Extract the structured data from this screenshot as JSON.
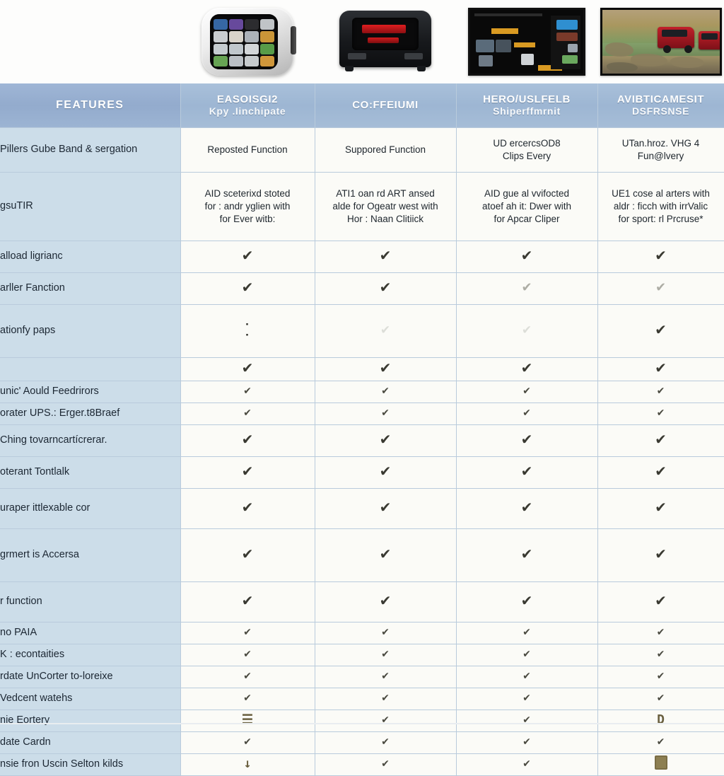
{
  "products": [
    {
      "name": "handheld-touchscreen-scanner",
      "type": "phone"
    },
    {
      "name": "rugged-diagnostic-tool",
      "type": "box"
    },
    {
      "name": "software-interface-screenshot",
      "type": "ui"
    },
    {
      "name": "offroad-vehicle-photo",
      "type": "photo"
    }
  ],
  "table": {
    "header": {
      "feature_label": "FEATURES",
      "columns": [
        {
          "title": "EASOISGI2",
          "subtitle": "Kpy .Iinchipate"
        },
        {
          "title": "CO:FFEIUMI",
          "subtitle": ""
        },
        {
          "title": "HERO/USLFELB",
          "subtitle": "Shiperffmrnit"
        },
        {
          "title": "AVIBTICAMESIT",
          "subtitle": "DSFRSNSE"
        }
      ]
    },
    "rows": [
      {
        "feature": "Pillers Gube Band & sergation",
        "size": "r-lead",
        "cells": [
          {
            "kind": "text",
            "lines": [
              "Reposted Function"
            ]
          },
          {
            "kind": "text",
            "lines": [
              "Suppored Function"
            ]
          },
          {
            "kind": "text",
            "lines": [
              "UD ercercsOD8",
              "Clips Every"
            ]
          },
          {
            "kind": "text",
            "lines": [
              "UTan.hroz. VHG 4",
              "Fun@lvery"
            ]
          }
        ]
      },
      {
        "feature": "gsuTIR",
        "size": "r-xtall",
        "cells": [
          {
            "kind": "text",
            "lines": [
              "AID sceterixd stoted",
              "for : andr yglien with",
              "for Ever witb:"
            ]
          },
          {
            "kind": "text",
            "lines": [
              "ATI1 oan rd ART ansed",
              "alde for Ogeatr west with",
              "Hor : Naan Clitiick"
            ]
          },
          {
            "kind": "text",
            "lines": [
              "AID gue al vvifocted",
              "atoef ah it: Dwer with",
              "for Apcar Cliper"
            ]
          },
          {
            "kind": "text",
            "lines": [
              "UE1 cose al arters with",
              "aldr : ficch with irrValic",
              "for sport: rl Prcruse*"
            ]
          }
        ]
      },
      {
        "feature": "alload ligrianc",
        "size": "r-reg",
        "cells": [
          {
            "kind": "check",
            "style": "big"
          },
          {
            "kind": "check",
            "style": "big"
          },
          {
            "kind": "check",
            "style": "big"
          },
          {
            "kind": "check",
            "style": "big"
          }
        ]
      },
      {
        "feature": "arller Fanction",
        "size": "r-reg",
        "cells": [
          {
            "kind": "check",
            "style": "big"
          },
          {
            "kind": "check",
            "style": "big"
          },
          {
            "kind": "check",
            "style": "faint"
          },
          {
            "kind": "check",
            "style": "faint"
          }
        ]
      },
      {
        "feature": "ationfy paps",
        "size": "r-tall",
        "cells": [
          {
            "kind": "dots",
            "style": "dots"
          },
          {
            "kind": "check",
            "style": "ghost"
          },
          {
            "kind": "check",
            "style": "ghost"
          },
          {
            "kind": "check",
            "style": "big"
          }
        ]
      },
      {
        "feature": "",
        "size": "r-small",
        "cells": [
          {
            "kind": "check",
            "style": "big"
          },
          {
            "kind": "check",
            "style": "big"
          },
          {
            "kind": "check",
            "style": "big"
          },
          {
            "kind": "check",
            "style": "big"
          }
        ]
      },
      {
        "feature": "unic' Aould Feedrirors",
        "size": "r-xsmall",
        "cells": [
          {
            "kind": "check",
            "style": "small"
          },
          {
            "kind": "check",
            "style": "small"
          },
          {
            "kind": "check",
            "style": "small"
          },
          {
            "kind": "check",
            "style": "small"
          }
        ]
      },
      {
        "feature": "orater UPS.: Erger.t8Braef",
        "size": "r-xsmall",
        "cells": [
          {
            "kind": "check",
            "style": "small"
          },
          {
            "kind": "check",
            "style": "small"
          },
          {
            "kind": "check",
            "style": "small"
          },
          {
            "kind": "check",
            "style": "small"
          }
        ]
      },
      {
        "feature": "Ching tovarncartícrerar.",
        "size": "r-reg",
        "cells": [
          {
            "kind": "check",
            "style": "big"
          },
          {
            "kind": "check",
            "style": "big"
          },
          {
            "kind": "check",
            "style": "big"
          },
          {
            "kind": "check",
            "style": "big"
          }
        ]
      },
      {
        "feature": "oterant Tontlalk",
        "size": "r-reg",
        "cells": [
          {
            "kind": "check",
            "style": "big"
          },
          {
            "kind": "check",
            "style": "big"
          },
          {
            "kind": "check",
            "style": "big"
          },
          {
            "kind": "check",
            "style": "big"
          }
        ]
      },
      {
        "feature": "uraper ittlexable cor",
        "size": "r-med",
        "cells": [
          {
            "kind": "check",
            "style": "big"
          },
          {
            "kind": "check",
            "style": "big"
          },
          {
            "kind": "check",
            "style": "big"
          },
          {
            "kind": "check",
            "style": "big"
          }
        ]
      },
      {
        "feature": "grmert is Accersa",
        "size": "r-tall",
        "cells": [
          {
            "kind": "check",
            "style": "big"
          },
          {
            "kind": "check",
            "style": "big"
          },
          {
            "kind": "check",
            "style": "big"
          },
          {
            "kind": "check",
            "style": "big"
          }
        ]
      },
      {
        "feature": "r function",
        "size": "r-med",
        "cells": [
          {
            "kind": "check",
            "style": "big"
          },
          {
            "kind": "check",
            "style": "big"
          },
          {
            "kind": "check",
            "style": "big"
          },
          {
            "kind": "check",
            "style": "big"
          }
        ]
      },
      {
        "feature": "no PAIA",
        "size": "r-xsmall",
        "cells": [
          {
            "kind": "check",
            "style": "small"
          },
          {
            "kind": "check",
            "style": "small"
          },
          {
            "kind": "check",
            "style": "small"
          },
          {
            "kind": "check",
            "style": "small"
          }
        ]
      },
      {
        "feature": "K : econtaities",
        "size": "r-xsmall",
        "cells": [
          {
            "kind": "check",
            "style": "small"
          },
          {
            "kind": "check",
            "style": "small"
          },
          {
            "kind": "check",
            "style": "small"
          },
          {
            "kind": "check",
            "style": "small"
          }
        ]
      },
      {
        "feature": "rdate UnCorter to-loreixe",
        "size": "r-xsmall",
        "cells": [
          {
            "kind": "check",
            "style": "small"
          },
          {
            "kind": "check",
            "style": "small"
          },
          {
            "kind": "check",
            "style": "small"
          },
          {
            "kind": "check",
            "style": "small"
          }
        ]
      },
      {
        "feature": "Vedcent watehs",
        "size": "r-xsmall",
        "cells": [
          {
            "kind": "check",
            "style": "small"
          },
          {
            "kind": "check",
            "style": "small"
          },
          {
            "kind": "check",
            "style": "small"
          },
          {
            "kind": "check",
            "style": "small"
          }
        ]
      },
      {
        "feature": "nie Eortery",
        "size": "r-xsmall",
        "cells": [
          {
            "kind": "glyph",
            "style": "glyph",
            "text": "☰"
          },
          {
            "kind": "check",
            "style": "small"
          },
          {
            "kind": "check",
            "style": "small"
          },
          {
            "kind": "glyph",
            "style": "glyph",
            "text": "D"
          }
        ]
      },
      {
        "feature": "date Cardn",
        "size": "r-xsmall",
        "cells": [
          {
            "kind": "check",
            "style": "small"
          },
          {
            "kind": "check",
            "style": "small"
          },
          {
            "kind": "check",
            "style": "small"
          },
          {
            "kind": "check",
            "style": "small"
          }
        ]
      },
      {
        "feature": "nsie fron Uscin Selton kilds",
        "size": "r-xsmall",
        "cells": [
          {
            "kind": "glyph",
            "style": "glyph",
            "text": "↓"
          },
          {
            "kind": "check",
            "style": "small"
          },
          {
            "kind": "check",
            "style": "small"
          },
          {
            "kind": "boxglyph",
            "style": "boxglyph",
            "text": ""
          }
        ]
      }
    ]
  },
  "colors": {
    "header_blue": "#a6bdd7",
    "feature_column": "#ccdde9",
    "data_cell": "#fbfbf7",
    "grid_line": "#b9cbdc",
    "check_color": "#3a3a32"
  },
  "icons": {
    "check": "✔"
  }
}
